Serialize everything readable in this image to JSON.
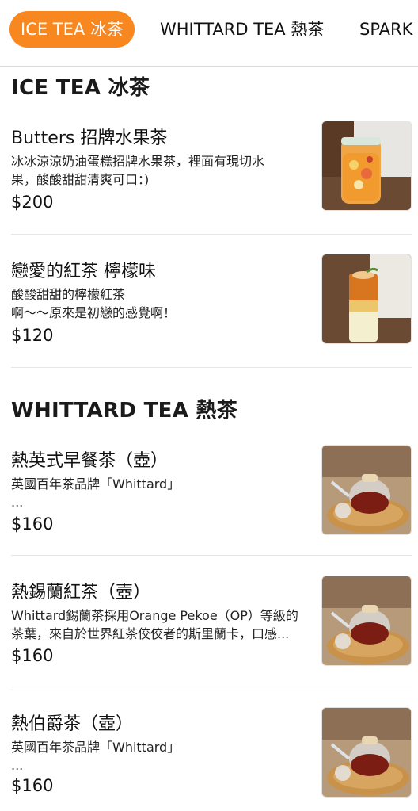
{
  "tabs": [
    {
      "label": "ICE TEA 冰茶",
      "active": true
    },
    {
      "label": "WHITTARD TEA 熱茶",
      "active": false
    },
    {
      "label": "SPARK",
      "active": false
    }
  ],
  "sections": [
    {
      "title": "ICE TEA 冰茶",
      "items": [
        {
          "name": "Butters 招牌水果茶",
          "desc_lines": [
            "冰冰涼涼奶油蛋糕招牌水果茶，裡面有現切水",
            "果，酸酸甜甜清爽可口：)"
          ],
          "price": "$200",
          "image": "fruit-tea-jar-image"
        },
        {
          "name": "戀愛的紅茶 檸檬味",
          "desc_lines": [
            "酸酸甜甜的檸檬紅茶",
            "啊～～原來是初戀的感覺啊！"
          ],
          "price": "$120",
          "image": "lemon-black-tea-glass-image"
        }
      ]
    },
    {
      "title": "WHITTARD TEA 熱茶",
      "items": [
        {
          "name": "熱英式早餐茶（壺）",
          "desc_lines": [
            "英國百年茶品牌「Whittard」",
            "..."
          ],
          "price": "$160",
          "image": "teapot-image"
        },
        {
          "name": "熱錫蘭紅茶（壺）",
          "desc_lines": [
            "Whittard錫蘭茶採用Orange Pekoe（OP）等級的",
            "茶葉，來自於世界紅茶佼佼者的斯里蘭卡，口感..."
          ],
          "price": "$160",
          "image": "teapot-image"
        },
        {
          "name": "熱伯爵茶（壺）",
          "desc_lines": [
            "英國百年茶品牌「Whittard」",
            "..."
          ],
          "price": "$160",
          "image": "teapot-image"
        }
      ]
    }
  ],
  "colors": {
    "accent": "#f7871e",
    "text": "#111111",
    "divider": "#e6e6e6"
  }
}
